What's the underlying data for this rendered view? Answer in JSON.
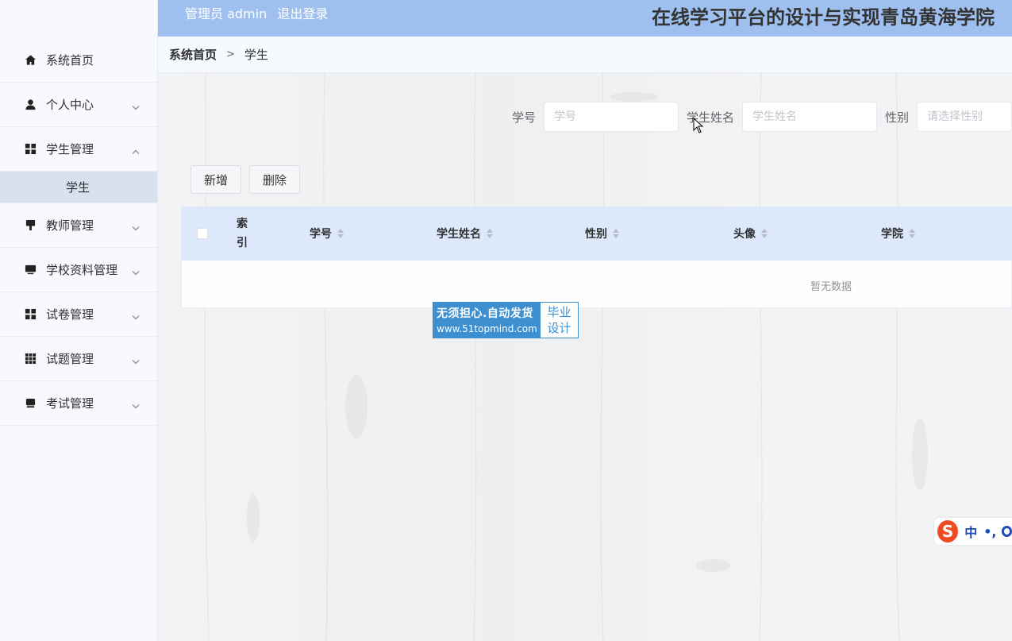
{
  "header": {
    "role_label": "管理员 admin",
    "logout_label": "退出登录",
    "title": "在线学习平台的设计与实现青岛黄海学院"
  },
  "sidebar": {
    "items": [
      {
        "label": "系统首页",
        "icon": "home-icon"
      },
      {
        "label": "个人中心",
        "icon": "user-icon"
      },
      {
        "label": "学生管理",
        "icon": "grid-icon",
        "expanded": true
      },
      {
        "label": "学生",
        "sub": true,
        "active": true
      },
      {
        "label": "教师管理",
        "icon": "monitor-icon"
      },
      {
        "label": "学校资料管理",
        "icon": "desktop-icon"
      },
      {
        "label": "试卷管理",
        "icon": "grid-icon"
      },
      {
        "label": "试题管理",
        "icon": "apps-icon"
      },
      {
        "label": "考试管理",
        "icon": "terminal-icon"
      }
    ]
  },
  "breadcrumb": {
    "home": "系统首页",
    "separator": ">",
    "current": "学生"
  },
  "search": {
    "student_no_label": "学号",
    "student_no_placeholder": "学号",
    "student_name_label": "学生姓名",
    "student_name_placeholder": "学生姓名",
    "gender_label": "性别",
    "gender_placeholder": "请选择性别"
  },
  "actions": {
    "add_label": "新增",
    "delete_label": "删除"
  },
  "table": {
    "columns": [
      "索引",
      "学号",
      "学生姓名",
      "性别",
      "头像",
      "学院"
    ],
    "empty_text": "暂无数据"
  },
  "promo": {
    "line1": "无须担心.自动发货",
    "line2": "www.51topmind.com",
    "right1": "毕业",
    "right2": "设计"
  },
  "ime": {
    "logo": "S",
    "mode": "中",
    "punct": "•,"
  },
  "colors": {
    "header_bg": "#9fc0ee",
    "table_head_bg": "#dde9fa",
    "submenu_active_bg": "#d8e2ef",
    "promo_blue": "#3d8fd0"
  }
}
